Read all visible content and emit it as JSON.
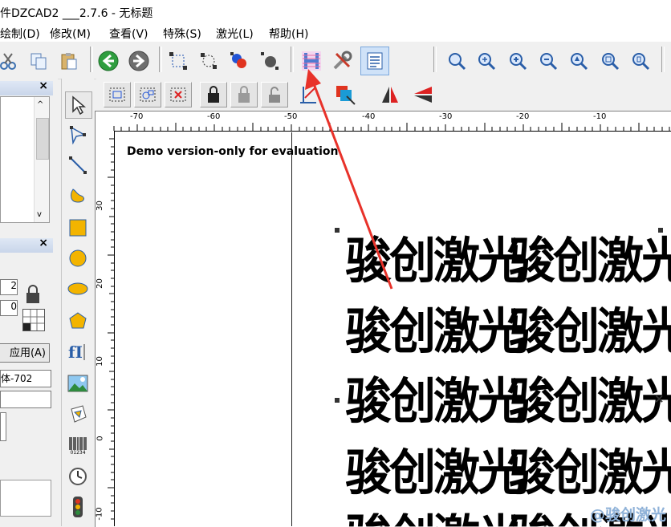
{
  "window": {
    "title": "件DZCAD2 ___2.7.6 - 无标题"
  },
  "menu": [
    {
      "id": "draw",
      "label": "绘制(D)"
    },
    {
      "id": "edit",
      "label": "修改(M)"
    },
    {
      "id": "view",
      "label": "查看(V)"
    },
    {
      "id": "special",
      "label": "特殊(S)"
    },
    {
      "id": "laser",
      "label": "激光(L)"
    },
    {
      "id": "help",
      "label": "帮助(H)"
    }
  ],
  "left_panel": {
    "field1_value": "2",
    "field2_value": "0",
    "apply_label": "应用(A)",
    "font_select_value": "体-702"
  },
  "toolbar_icons": [
    "cut-icon",
    "copy-icon",
    "paste-icon",
    "back-icon",
    "forward-icon",
    "node-select-icon",
    "node-edit-icon",
    "color-node-icon",
    "dark-node-icon",
    "hatch-icon",
    "tools-icon",
    "properties-icon",
    "zoom-icon",
    "zoom-in-icon",
    "zoom-in-alt-icon",
    "zoom-out-icon",
    "zoom-pan-icon",
    "zoom-all-icon",
    "zoom-page-icon"
  ],
  "draw_tools": [
    "select-arrow-icon",
    "node-select-icon",
    "line-icon",
    "curve-icon",
    "rectangle-icon",
    "circle-icon",
    "ellipse-icon",
    "polygon-icon",
    "text-icon",
    "bitmap-icon",
    "vector-file-icon",
    "barcode-icon",
    "clock-icon",
    "traffic-light-icon"
  ],
  "canvas": {
    "demo_notice": "Demo version-only for evaluation",
    "text_rows": [
      [
        "骏创激光",
        "骏创激光"
      ],
      [
        "骏创激光",
        "骏创激光"
      ],
      [
        "骏创激光",
        "骏创激光"
      ],
      [
        "骏创激光",
        "骏创激光"
      ],
      [
        "骏创激光",
        "骏创激光"
      ]
    ],
    "h_ruler_labels": [
      "-70",
      "-60",
      "-50",
      "-40",
      "-30",
      "-20",
      "-10"
    ],
    "v_ruler_labels": [
      "30",
      "20",
      "10",
      "0",
      "-10"
    ],
    "barcode_caption": "01234"
  },
  "watermark": "@骏创激光",
  "accent": {
    "arrow": "#e8322a",
    "selection": "#333333"
  }
}
